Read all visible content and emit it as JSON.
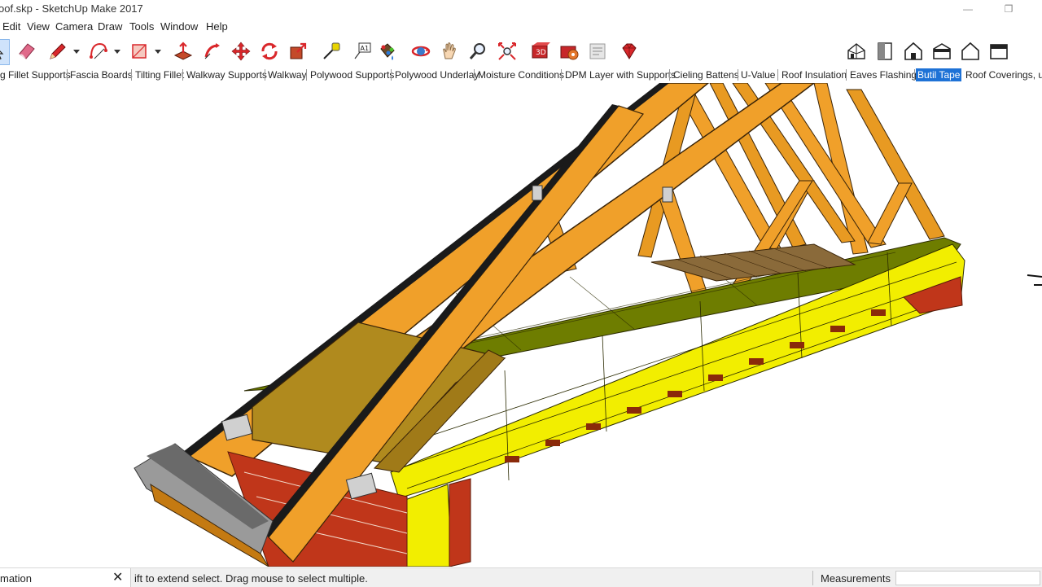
{
  "window": {
    "title": "oof.skp - SketchUp Make 2017",
    "minimize_glyph": "—",
    "restore_glyph": "❐"
  },
  "menu": [
    "Edit",
    "View",
    "Camera",
    "Draw",
    "Tools",
    "Window",
    "Help"
  ],
  "toolbar": {
    "icons": [
      "select-icon",
      "eraser-icon",
      "pencil-icon",
      "arc-icon",
      "shape-icon",
      "push-pull-icon",
      "follow-me-icon",
      "move-icon",
      "rotate-icon",
      "scale-icon",
      "tape-measure-icon",
      "text-icon",
      "paint-bucket-icon",
      "orbit-icon",
      "pan-icon",
      "zoom-icon",
      "zoom-extents-icon",
      "3d-warehouse-icon",
      "extension-warehouse-icon",
      "layout-icon",
      "ruby-icon"
    ],
    "view_icons": [
      "iso-view-icon",
      "top-view-icon",
      "front-view-icon",
      "right-view-icon",
      "back-view-icon",
      "left-view-icon"
    ],
    "accent_red": "#d9272b",
    "accent_orange": "#e4762a"
  },
  "scene_tabs": [
    {
      "label": "g Fillet Supports",
      "active": false
    },
    {
      "label": "Fascia Boards",
      "active": false
    },
    {
      "label": "Tilting Fillet",
      "active": false
    },
    {
      "label": "Walkway Supports",
      "active": false
    },
    {
      "label": "Walkway",
      "active": false
    },
    {
      "label": "Polywood Supports",
      "active": false
    },
    {
      "label": "Polywood Underlay",
      "active": false
    },
    {
      "label": "Moisture Conditions",
      "active": false
    },
    {
      "label": "DPM Layer with Supports",
      "active": false
    },
    {
      "label": "Cieling Battens",
      "active": false
    },
    {
      "label": "U-Value",
      "active": false
    },
    {
      "label": "Roof Insulation",
      "active": false
    },
    {
      "label": "Eaves Flashing",
      "active": false
    },
    {
      "label": "Butil Tape",
      "active": true
    },
    {
      "label": "Roof Coverings, un",
      "active": false
    }
  ],
  "model": {
    "colors": {
      "timber": "#f0a02a",
      "timber_dark": "#c47a12",
      "insulation": "#f2ee00",
      "insulation_top": "#6e7d00",
      "board": "#b08a1e",
      "brick": "#c0361a",
      "flashing": "#9a9a9a"
    }
  },
  "status": {
    "panel_title": "mation",
    "close_glyph": "✕",
    "message": "ift to extend select. Drag mouse to select multiple.",
    "measurements_label": "Measurements",
    "measurements_value": ""
  }
}
